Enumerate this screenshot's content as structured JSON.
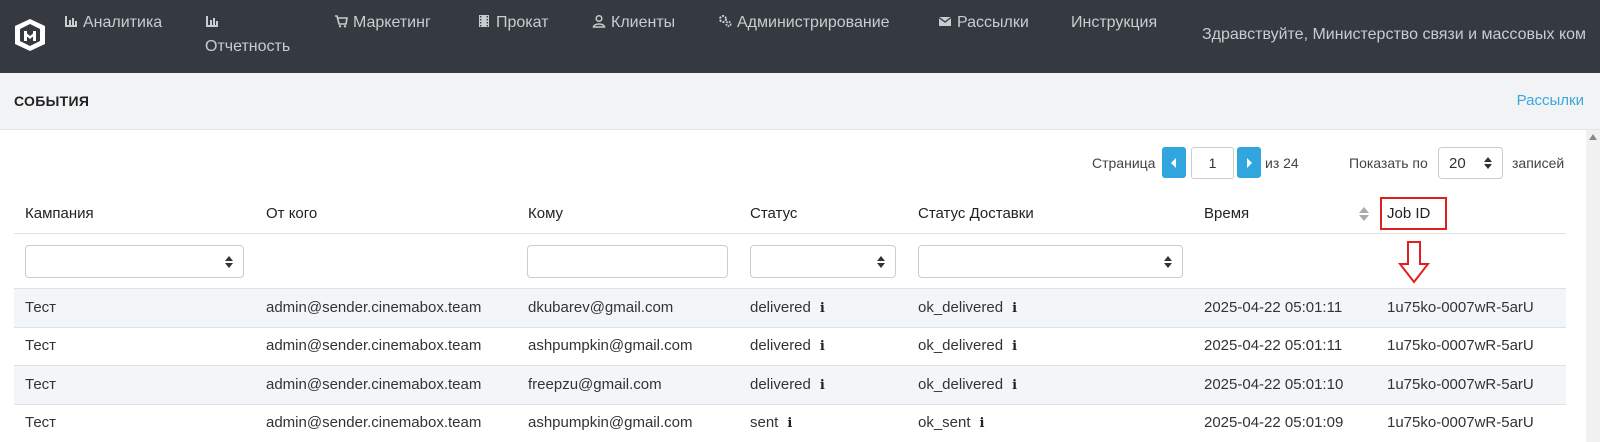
{
  "nav": {
    "items": [
      {
        "label": "Аналитика",
        "icon": "bar-chart-icon"
      },
      {
        "label": "Отчетность",
        "icon": "bar-chart-icon"
      },
      {
        "label": "Маркетинг",
        "icon": "cart-icon"
      },
      {
        "label": "Прокат",
        "icon": "film-icon"
      },
      {
        "label": "Клиенты",
        "icon": "user-icon"
      },
      {
        "label": "Администрирование",
        "icon": "gears-icon"
      },
      {
        "label": "Рассылки",
        "icon": "envelope-icon"
      },
      {
        "label": "Инструкция",
        "icon": ""
      }
    ],
    "greeting": "Здравствуйте, Министерство связи и массовых ком"
  },
  "header": {
    "title": "СОБЫТИЯ",
    "breadcrumb": "Рассылки"
  },
  "pagination": {
    "page_label": "Страница",
    "page": "1",
    "of_label": "из 24",
    "show_label": "Показать по",
    "per_page": "20",
    "records_label": "записей"
  },
  "table": {
    "columns": [
      "Кампания",
      "От кого",
      "Кому",
      "Статус",
      "Статус Доставки",
      "Время",
      "Job ID"
    ],
    "rows": [
      {
        "campaign": "Тест",
        "from": "admin@sender.cinemabox.team",
        "to": "dkubarev@gmail.com",
        "status": "delivered",
        "delivery": "ok_delivered",
        "time": "2025-04-22 05:01:11",
        "job_id": "1u75ko-0007wR-5arU"
      },
      {
        "campaign": "Тест",
        "from": "admin@sender.cinemabox.team",
        "to": "ashpumpkin@gmail.com",
        "status": "delivered",
        "delivery": "ok_delivered",
        "time": "2025-04-22 05:01:11",
        "job_id": "1u75ko-0007wR-5arU"
      },
      {
        "campaign": "Тест",
        "from": "admin@sender.cinemabox.team",
        "to": "freepzu@gmail.com",
        "status": "delivered",
        "delivery": "ok_delivered",
        "time": "2025-04-22 05:01:10",
        "job_id": "1u75ko-0007wR-5arU"
      },
      {
        "campaign": "Тест",
        "from": "admin@sender.cinemabox.team",
        "to": "ashpumpkin@gmail.com",
        "status": "sent",
        "delivery": "ok_sent",
        "time": "2025-04-22 05:01:09",
        "job_id": "1u75ko-0007wR-5arU"
      }
    ]
  },
  "colors": {
    "nav_bg": "#343a40",
    "accent": "#31a5dd",
    "highlight": "#e02020"
  }
}
